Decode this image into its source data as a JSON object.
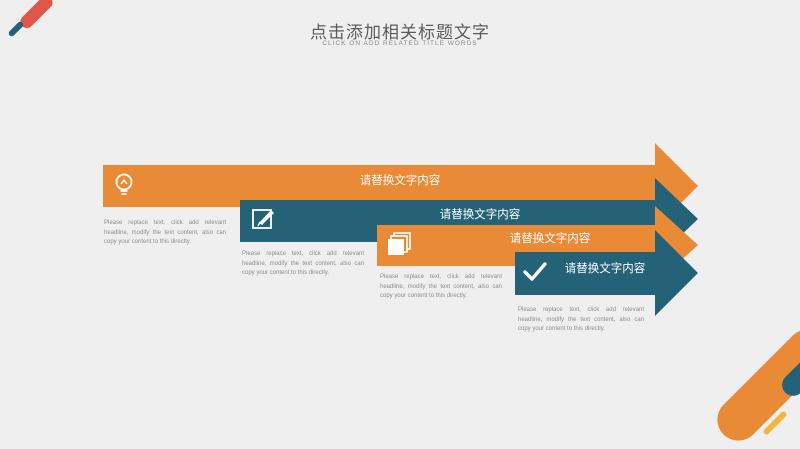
{
  "slide": {
    "title": "点击添加相关标题文字",
    "subtitle": "CLICK ON ADD RELATED TITLE WORDS",
    "colors": {
      "orange": "#e98a37",
      "teal": "#236277",
      "red": "#e0574a",
      "yellow": "#f2b83e",
      "background": "#efefef"
    },
    "steps": [
      {
        "label": "请替换文字内容",
        "icon": "lightbulb-icon",
        "color": "orange",
        "description": "Please replace text, click add relevant headline, modify the text content, also can copy your content to this directly."
      },
      {
        "label": "请替换文字内容",
        "icon": "pencil-icon",
        "color": "teal",
        "description": "Please replace text, click add relevant headline, modify the text content, also can copy your content to this directly."
      },
      {
        "label": "请替换文字内容",
        "icon": "pages-icon",
        "color": "orange",
        "description": "Please replace text, click add relevant headline, modify the text content, also can copy your content to this directly."
      },
      {
        "label": "请替换文字内容",
        "icon": "checkmark-icon",
        "color": "teal",
        "description": "Please replace text, click add relevant headline, modify the text content, also can copy your content to this directly."
      }
    ]
  }
}
